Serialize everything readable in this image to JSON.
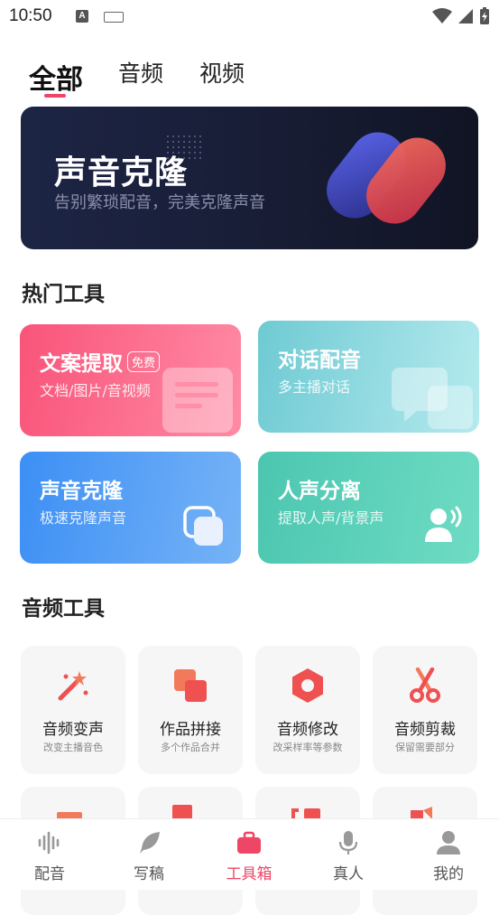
{
  "status_bar": {
    "time": "10:50",
    "notif_letter": "A"
  },
  "top_tabs": [
    {
      "label": "全部",
      "active": true
    },
    {
      "label": "音频",
      "active": false
    },
    {
      "label": "视频",
      "active": false
    }
  ],
  "banner": {
    "title": "声音克隆",
    "subtitle": "告别繁琐配音，完美克隆声音"
  },
  "hot_tools": {
    "title": "热门工具",
    "items": [
      {
        "title": "文案提取",
        "badge": "免费",
        "subtitle": "文档/图片/音视频",
        "icon": "document-icon"
      },
      {
        "title": "对话配音",
        "subtitle": "多主播对话",
        "icon": "chat-bubbles-icon"
      },
      {
        "title": "声音克隆",
        "subtitle": "极速克隆声音",
        "icon": "copy-icon"
      },
      {
        "title": "人声分离",
        "subtitle": "提取人声/背景声",
        "icon": "voice-user-icon"
      }
    ]
  },
  "audio_tools": {
    "title": "音频工具",
    "items": [
      {
        "name": "音频变声",
        "desc": "改变主播音色",
        "icon": "magic-wand-icon"
      },
      {
        "name": "作品拼接",
        "desc": "多个作品合并",
        "icon": "merge-icon"
      },
      {
        "name": "音频修改",
        "desc": "改采样率等参数",
        "icon": "nut-icon"
      },
      {
        "name": "音频剪裁",
        "desc": "保留需要部分",
        "icon": "scissors-icon"
      }
    ]
  },
  "bottom_nav": [
    {
      "label": "配音",
      "icon": "waveform-icon",
      "active": false
    },
    {
      "label": "写稿",
      "icon": "feather-icon",
      "active": false
    },
    {
      "label": "工具箱",
      "icon": "toolbox-icon",
      "active": true
    },
    {
      "label": "真人",
      "icon": "microphone-icon",
      "active": false
    },
    {
      "label": "我的",
      "icon": "person-icon",
      "active": false
    }
  ],
  "colors": {
    "accent": "#ee4667"
  }
}
